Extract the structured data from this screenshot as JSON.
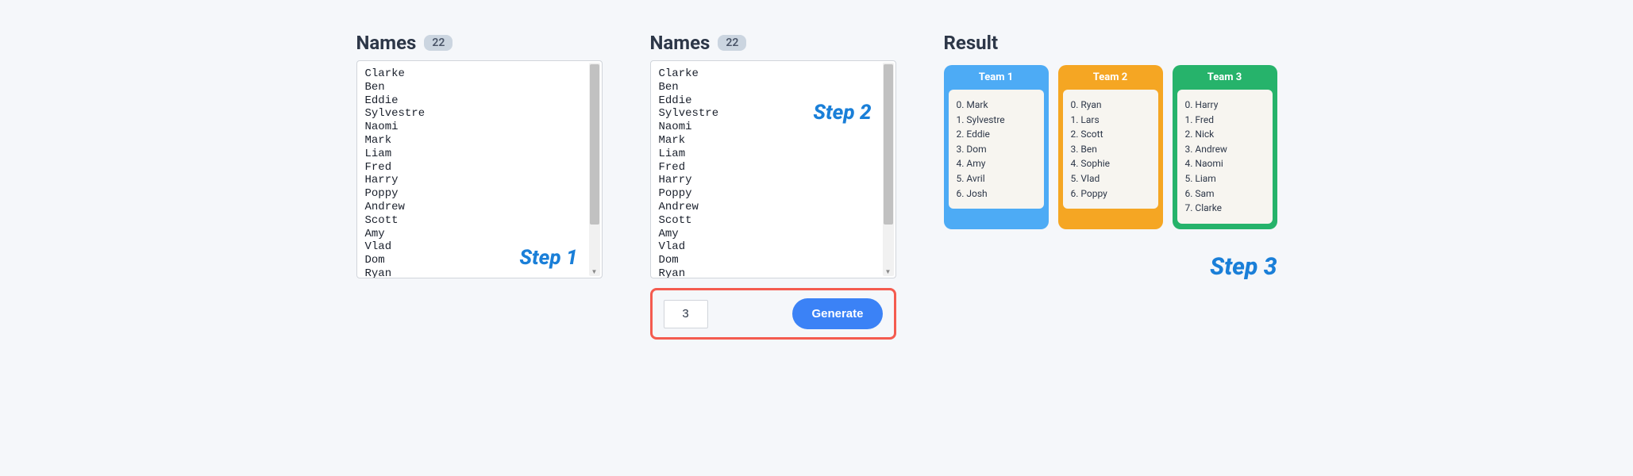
{
  "step_labels": {
    "step1": "Step 1",
    "step2": "Step 2",
    "step3": "Step 3"
  },
  "panel1": {
    "title": "Names",
    "count": "22",
    "names": "Clarke\nBen\nEddie\nSylvestre\nNaomi\nMark\nLiam\nFred\nHarry\nPoppy\nAndrew\nScott\nAmy\nVlad\nDom\nRyan"
  },
  "panel2": {
    "title": "Names",
    "count": "22",
    "names": "Clarke\nBen\nEddie\nSylvestre\nNaomi\nMark\nLiam\nFred\nHarry\nPoppy\nAndrew\nScott\nAmy\nVlad\nDom\nRyan",
    "team_count_value": "3",
    "generate_label": "Generate"
  },
  "result": {
    "title": "Result",
    "teams": [
      {
        "header": "Team 1",
        "members": [
          "Mark",
          "Sylvestre",
          "Eddie",
          "Dom",
          "Amy",
          "Avril",
          "Josh"
        ]
      },
      {
        "header": "Team 2",
        "members": [
          "Ryan",
          "Lars",
          "Scott",
          "Ben",
          "Sophie",
          "Vlad",
          "Poppy"
        ]
      },
      {
        "header": "Team 3",
        "members": [
          "Harry",
          "Fred",
          "Nick",
          "Andrew",
          "Naomi",
          "Liam",
          "Sam",
          "Clarke"
        ]
      }
    ]
  }
}
